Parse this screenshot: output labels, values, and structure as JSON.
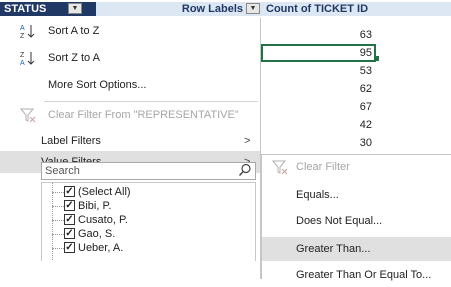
{
  "header": {
    "status_label": "STATUS",
    "row_labels": "Row Labels",
    "count_label": "Count of TICKET ID"
  },
  "values": [
    "63",
    "95",
    "53",
    "62",
    "67",
    "42",
    "30"
  ],
  "menu": {
    "sort_az": "Sort A to Z",
    "sort_za": "Sort Z to A",
    "more_sort": "More Sort Options...",
    "clear_filter": "Clear Filter From \"REPRESENTATIVE\"",
    "label_filters": "Label Filters",
    "value_filters": "Value Filters",
    "search_placeholder": "Search",
    "list_items": [
      "(Select All)",
      "Bibi, P.",
      "Cusato, P.",
      "Gao, S.",
      "Ueber, A."
    ]
  },
  "submenu": {
    "clear_filter": "Clear Filter",
    "equals": "Equals...",
    "not_equal": "Does Not Equal...",
    "greater_than": "Greater Than...",
    "greater_equal": "Greater Than Or Equal To..."
  },
  "colors": {
    "status_header_bg": "#1f3864",
    "label_header_bg": "#dde7f3",
    "selection_green": "#217346",
    "hover_gray": "#e0e0e0"
  }
}
